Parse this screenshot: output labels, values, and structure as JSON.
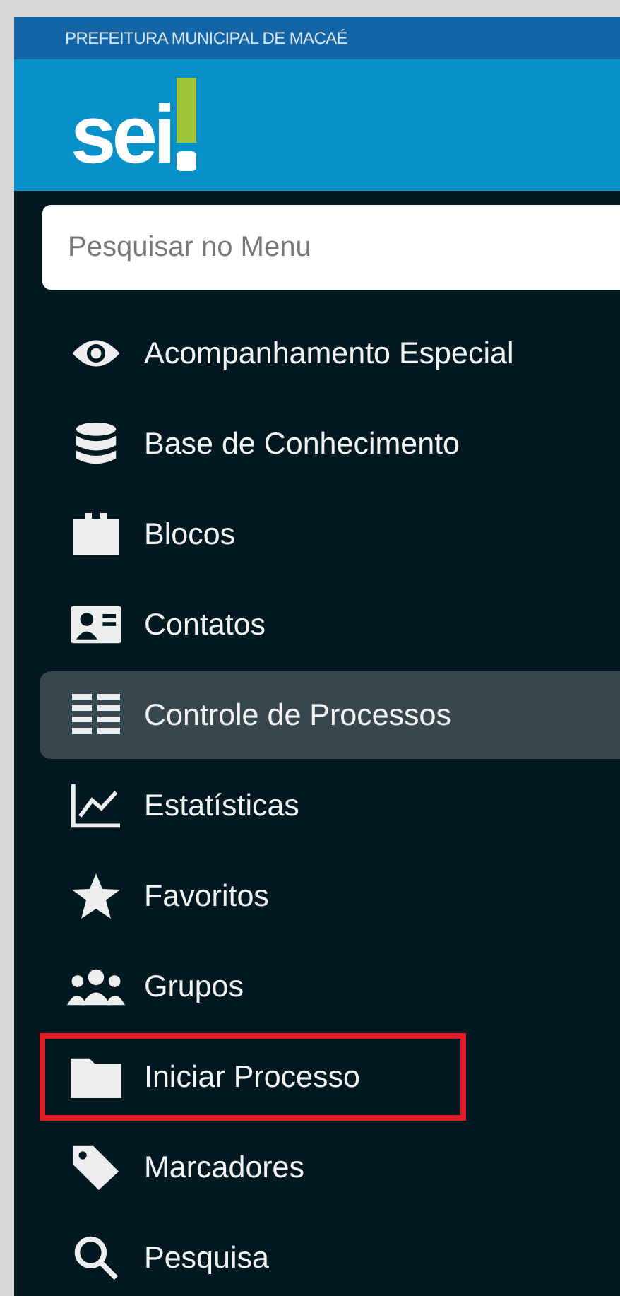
{
  "header": {
    "organization": "PREFEITURA MUNICIPAL DE MACAÉ",
    "logo": "sei"
  },
  "search": {
    "placeholder": "Pesquisar no Menu"
  },
  "menu": [
    {
      "label": "Acompanhamento Especial",
      "selected": false,
      "highlighted": false
    },
    {
      "label": "Base de Conhecimento",
      "selected": false,
      "highlighted": false
    },
    {
      "label": "Blocos",
      "selected": false,
      "highlighted": false
    },
    {
      "label": "Contatos",
      "selected": false,
      "highlighted": false
    },
    {
      "label": "Controle de Processos",
      "selected": true,
      "highlighted": false
    },
    {
      "label": "Estatísticas",
      "selected": false,
      "highlighted": false
    },
    {
      "label": "Favoritos",
      "selected": false,
      "highlighted": false
    },
    {
      "label": "Grupos",
      "selected": false,
      "highlighted": false
    },
    {
      "label": "Iniciar Processo",
      "selected": false,
      "highlighted": true
    },
    {
      "label": "Marcadores",
      "selected": false,
      "highlighted": false
    },
    {
      "label": "Pesquisa",
      "selected": false,
      "highlighted": false
    }
  ]
}
